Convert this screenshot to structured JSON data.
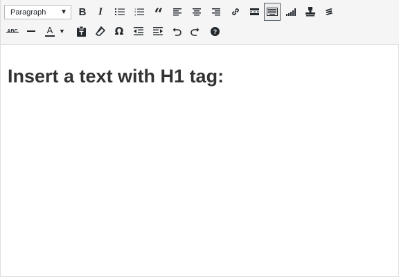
{
  "toolbar": {
    "format_select": {
      "value": "Paragraph"
    },
    "row1": [
      {
        "name": "bold-button",
        "icon": "bold-icon",
        "glyph": "B"
      },
      {
        "name": "italic-button",
        "icon": "italic-icon",
        "glyph": "I"
      },
      {
        "name": "bullet-list-button",
        "icon": "bullet-list-icon"
      },
      {
        "name": "numbered-list-button",
        "icon": "numbered-list-icon"
      },
      {
        "name": "blockquote-button",
        "icon": "blockquote-icon",
        "glyph": "“"
      },
      {
        "name": "align-left-button",
        "icon": "align-left-icon"
      },
      {
        "name": "align-center-button",
        "icon": "align-center-icon"
      },
      {
        "name": "align-right-button",
        "icon": "align-right-icon"
      },
      {
        "name": "insert-link-button",
        "icon": "link-icon"
      },
      {
        "name": "read-more-button",
        "icon": "read-more-icon"
      },
      {
        "name": "toolbar-toggle-button",
        "icon": "keyboard-icon",
        "active": true
      },
      {
        "name": "seo-analysis-button",
        "icon": "signal-bars-icon"
      },
      {
        "name": "shortcode-button",
        "icon": "stamp-icon"
      },
      {
        "name": "plugin-button",
        "icon": "zigzag-icon"
      }
    ],
    "row2": [
      {
        "name": "strikethrough-button",
        "icon": "strikethrough-icon",
        "glyph": "ABC"
      },
      {
        "name": "horizontal-line-button",
        "icon": "horizontal-line-icon"
      },
      {
        "name": "text-color-button",
        "icon": "text-color-icon",
        "glyph": "A"
      },
      {
        "name": "paste-as-text-button",
        "icon": "paste-text-icon"
      },
      {
        "name": "clear-formatting-button",
        "icon": "eraser-icon"
      },
      {
        "name": "special-character-button",
        "icon": "omega-icon",
        "glyph": "Ω"
      },
      {
        "name": "outdent-button",
        "icon": "outdent-icon"
      },
      {
        "name": "indent-button",
        "icon": "indent-icon"
      },
      {
        "name": "undo-button",
        "icon": "undo-icon"
      },
      {
        "name": "redo-button",
        "icon": "redo-icon"
      },
      {
        "name": "help-button",
        "icon": "help-icon"
      }
    ]
  },
  "content": {
    "heading": "Insert a text with H1 tag:"
  }
}
